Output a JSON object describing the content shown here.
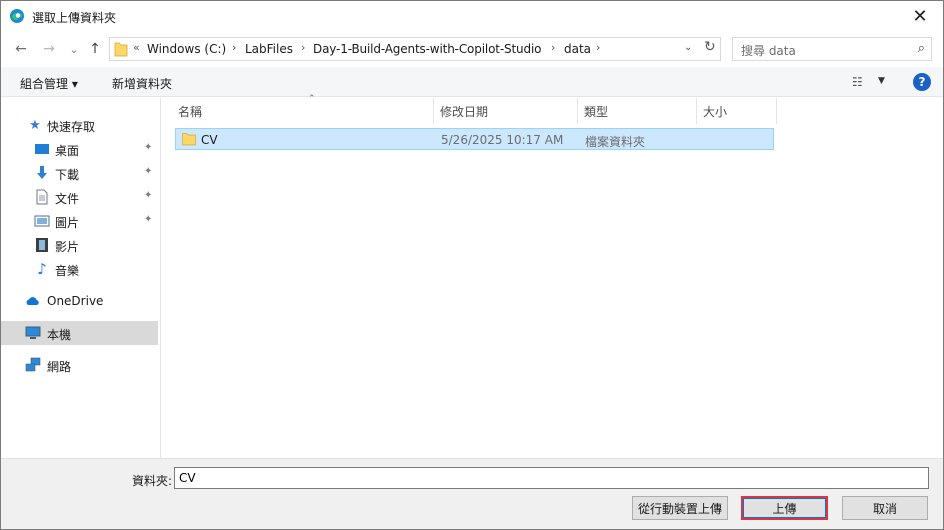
{
  "window": {
    "title": "選取上傳資料夾",
    "close_glyph": "✕"
  },
  "nav": {
    "back_glyph": "←",
    "forward_glyph": "→",
    "recent_glyph": "⌄",
    "up_glyph": "↑"
  },
  "address": {
    "overflow": "«",
    "crumbs": [
      "Windows (C:)",
      "LabFiles",
      "Day-1-Build-Agents-with-Copilot-Studio",
      "data"
    ],
    "separator": "›",
    "dropdown_glyph": "⌄",
    "refresh_glyph": "↻"
  },
  "search": {
    "placeholder": "搜尋 data",
    "icon_glyph": "⌕"
  },
  "toolbar": {
    "organize": "組合管理 ▾",
    "new_folder": "新增資料夾",
    "view_glyph": "☷",
    "view_drop": "▼",
    "help": "?"
  },
  "sidebar": {
    "quick_access": "快速存取",
    "items": [
      {
        "label": "桌面",
        "pinned": true
      },
      {
        "label": "下載",
        "pinned": true
      },
      {
        "label": "文件",
        "pinned": true
      },
      {
        "label": "圖片",
        "pinned": true
      },
      {
        "label": "影片",
        "pinned": false
      },
      {
        "label": "音樂",
        "pinned": false
      }
    ],
    "pin_glyph": "📌",
    "onedrive": "OneDrive",
    "this_pc": "本機",
    "network": "網路"
  },
  "columns": {
    "name": "名稱",
    "modified": "修改日期",
    "type": "類型",
    "size": "大小",
    "sort_glyph": "⌃"
  },
  "files": [
    {
      "name": "CV",
      "modified": "5/26/2025 10:17 AM",
      "type": "檔案資料夾",
      "size": ""
    }
  ],
  "bottom": {
    "folder_label": "資料夾:",
    "folder_value": "CV",
    "mobile_button": "從行動裝置上傳",
    "upload_button": "上傳",
    "cancel_button": "取消"
  },
  "colors": {
    "selection_bg": "#cce8ff",
    "selection_border": "#99d1ff",
    "help_blue": "#1a62c6",
    "highlight_red": "#e0333d",
    "folder_yellow": "#ffd769"
  }
}
